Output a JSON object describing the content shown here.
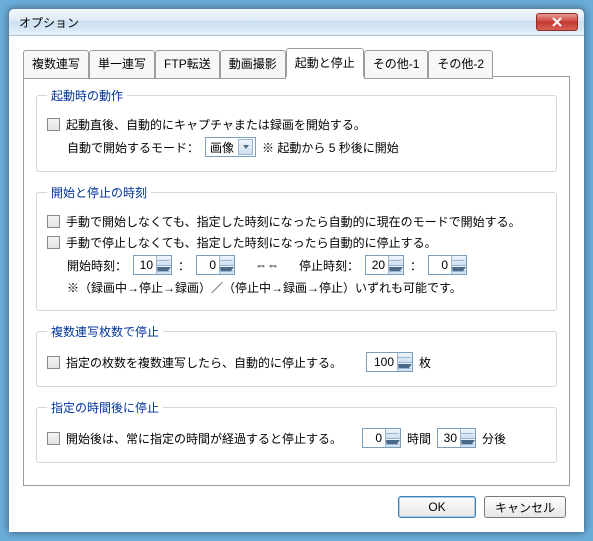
{
  "window": {
    "title": "オプション"
  },
  "tabs": {
    "items": [
      {
        "label": "複数連写"
      },
      {
        "label": "単一連写"
      },
      {
        "label": "FTP転送"
      },
      {
        "label": "動画撮影"
      },
      {
        "label": "起動と停止"
      },
      {
        "label": "その他-1"
      },
      {
        "label": "その他-2"
      }
    ],
    "active_index": 4
  },
  "group_startup": {
    "legend": "起動時の動作",
    "cb1_label": "起動直後、自動的にキャプチャまたは録画を開始する。",
    "mode_label": "自動で開始するモード：",
    "mode_value": "画像",
    "mode_note": "※ 起動から 5 秒後に開始"
  },
  "group_time": {
    "legend": "開始と停止の時刻",
    "cb1_label": "手動で開始しなくても、指定した時刻になったら自動的に現在のモードで開始する。",
    "cb2_label": "手動で停止しなくても、指定した時刻になったら自動的に停止する。",
    "start_label": "開始時刻：",
    "start_h": "10",
    "start_m": "0",
    "swap_symbol": "⇔⇔",
    "stop_label": "停止時刻：",
    "stop_h": "20",
    "stop_m": "0",
    "colon": "：",
    "note": "※（録画中→停止→録画）／（停止中→録画→停止）いずれも可能です。"
  },
  "group_count": {
    "legend": "複数連写枚数で停止",
    "cb_label": "指定の枚数を複数連写したら、自動的に停止する。",
    "value": "100",
    "suffix": "枚"
  },
  "group_duration": {
    "legend": "指定の時間後に停止",
    "cb_label": "開始後は、常に指定の時間が経過すると停止する。",
    "hours": "0",
    "hours_label": "時間",
    "minutes": "30",
    "minutes_label": "分後"
  },
  "buttons": {
    "ok": "OK",
    "cancel": "キャンセル"
  }
}
